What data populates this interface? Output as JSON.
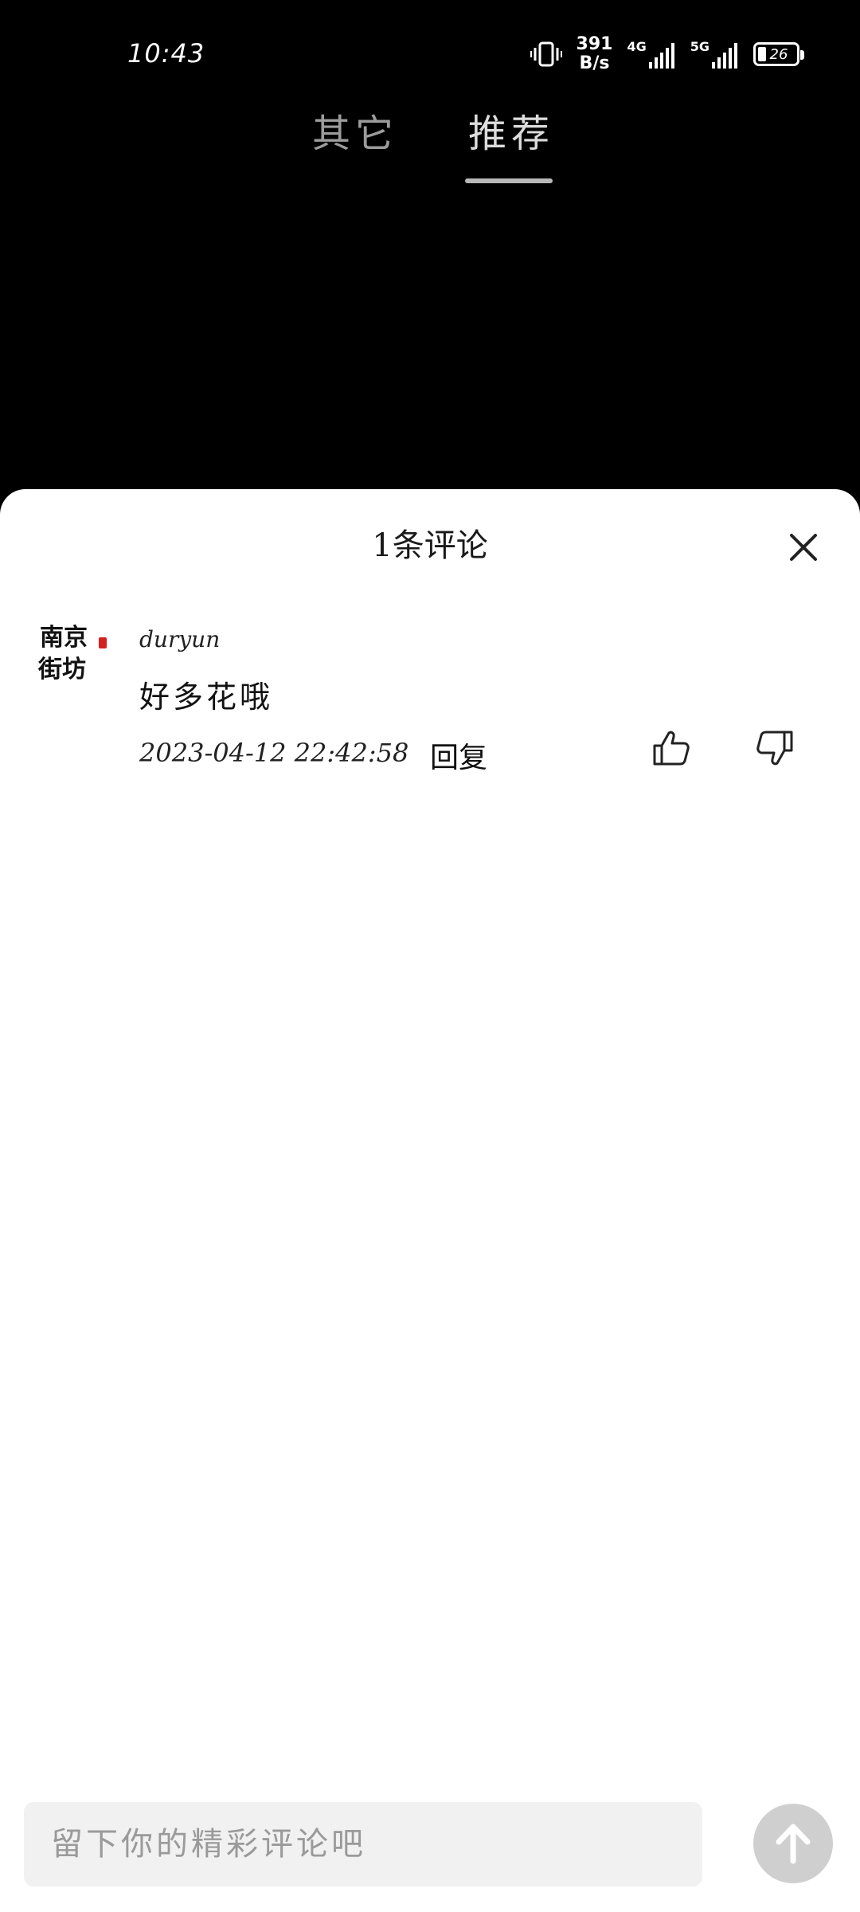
{
  "status_bar": {
    "time": "10:43",
    "net_speed_value": "391",
    "net_speed_unit": "B/s",
    "signal_1_label": "4G",
    "signal_2_label": "5G",
    "battery": "26"
  },
  "top_tabs": [
    {
      "label": "其它",
      "active": false
    },
    {
      "label": "推荐",
      "active": true
    }
  ],
  "sheet": {
    "title": "1条评论"
  },
  "comments": [
    {
      "user": "duryun",
      "text": "好多花哦",
      "time": "2023-04-12 22:42:58",
      "reply_label": "回复",
      "avatar_text_line1": "南京",
      "avatar_text_line2": "街坊"
    }
  ],
  "input": {
    "placeholder": "留下你的精彩评论吧"
  },
  "icons": {
    "close": "close-icon",
    "like": "thumbs-up-icon",
    "dislike": "thumbs-down-icon",
    "send": "arrow-up-icon"
  }
}
